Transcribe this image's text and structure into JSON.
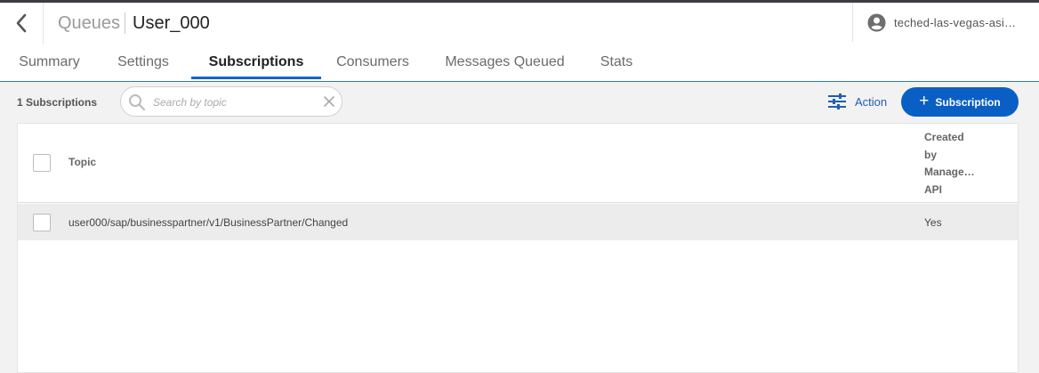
{
  "header": {
    "breadcrumb_parent": "Queues",
    "queue_name": "User_000",
    "account_name": "teched-las-vegas-asi…"
  },
  "tabs": [
    {
      "label": "Summary",
      "active": false
    },
    {
      "label": "Settings",
      "active": false
    },
    {
      "label": "Subscriptions",
      "active": true
    },
    {
      "label": "Consumers",
      "active": false
    },
    {
      "label": "Messages Queued",
      "active": false
    },
    {
      "label": "Stats",
      "active": false
    }
  ],
  "toolbar": {
    "count_label": "1 Subscriptions",
    "search_placeholder": "Search by topic",
    "action_label": "Action",
    "add_button_label": "Subscription"
  },
  "table": {
    "columns": [
      "Topic",
      "Created by Manage… API"
    ],
    "created_header_lines": [
      "Created",
      "by",
      "Manage…",
      "API"
    ],
    "rows": [
      {
        "topic": "user000/sap/businesspartner/v1/BusinessPartner/Changed",
        "created_by_api": "Yes"
      }
    ]
  },
  "colors": {
    "accent": "#0a5fc4",
    "tab_underline": "#1565c0",
    "action_text": "#1f5fae"
  }
}
